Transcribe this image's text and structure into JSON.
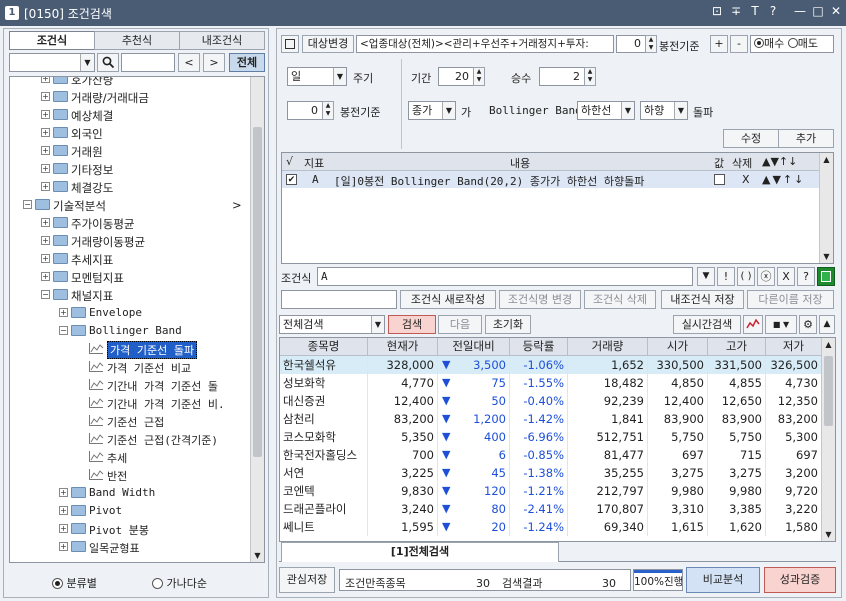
{
  "window": {
    "number": "1",
    "title": "[0150] 조건검색",
    "controls": [
      "⊡",
      "∓",
      "T",
      "?",
      "—",
      "□",
      "✕"
    ]
  },
  "left": {
    "tabs": [
      "조건식",
      "추천식",
      "내조건식"
    ],
    "search_nav": [
      "<",
      ">"
    ],
    "all_button": "전체",
    "tree": [
      {
        "label": "호가잔량",
        "indent": 1,
        "icon": "folder",
        "exp": "+"
      },
      {
        "label": "거래량/거래대금",
        "indent": 1,
        "icon": "folder",
        "exp": "+"
      },
      {
        "label": "예상체결",
        "indent": 1,
        "icon": "folder",
        "exp": "+"
      },
      {
        "label": "외국인",
        "indent": 1,
        "icon": "folder",
        "exp": "+"
      },
      {
        "label": "거래원",
        "indent": 1,
        "icon": "folder",
        "exp": "+"
      },
      {
        "label": "기타정보",
        "indent": 1,
        "icon": "folder",
        "exp": "+"
      },
      {
        "label": "체결강도",
        "indent": 1,
        "icon": "folder",
        "exp": "+"
      },
      {
        "label": "기술적분석",
        "indent": 0,
        "icon": "folder",
        "exp": "−",
        "arrow": ">"
      },
      {
        "label": "주가이동평균",
        "indent": 1,
        "icon": "folder",
        "exp": "+"
      },
      {
        "label": "거래량이동평균",
        "indent": 1,
        "icon": "folder",
        "exp": "+"
      },
      {
        "label": "추세지표",
        "indent": 1,
        "icon": "folder",
        "exp": "+"
      },
      {
        "label": "모멘텀지표",
        "indent": 1,
        "icon": "folder",
        "exp": "+"
      },
      {
        "label": "채널지표",
        "indent": 1,
        "icon": "folder",
        "exp": "−"
      },
      {
        "label": "Envelope",
        "indent": 2,
        "icon": "folder",
        "exp": "+"
      },
      {
        "label": "Bollinger Band",
        "indent": 2,
        "icon": "folder",
        "exp": "−"
      },
      {
        "label": "가격 기준선 돌파",
        "indent": 3,
        "icon": "chart",
        "selected": true
      },
      {
        "label": "가격 기준선 비교",
        "indent": 3,
        "icon": "chart"
      },
      {
        "label": "기간내 가격 기준선 돌",
        "indent": 3,
        "icon": "chart"
      },
      {
        "label": "기간내 가격 기준선 비.",
        "indent": 3,
        "icon": "chart"
      },
      {
        "label": "기준선 근접",
        "indent": 3,
        "icon": "chart"
      },
      {
        "label": "기준선 근접(간격기준)",
        "indent": 3,
        "icon": "chart"
      },
      {
        "label": "추세",
        "indent": 3,
        "icon": "chart"
      },
      {
        "label": "반전",
        "indent": 3,
        "icon": "chart"
      },
      {
        "label": "Band Width",
        "indent": 2,
        "icon": "folder",
        "exp": "+"
      },
      {
        "label": "Pivot",
        "indent": 2,
        "icon": "folder",
        "exp": "+"
      },
      {
        "label": "Pivot 분봉",
        "indent": 2,
        "icon": "folder",
        "exp": "+"
      },
      {
        "label": "일목균형표",
        "indent": 2,
        "icon": "folder",
        "exp": "+"
      }
    ],
    "radio": [
      "분류별",
      "가나다순"
    ]
  },
  "cond": {
    "target_btn": "대상변경",
    "target_text": "<업종대상(전체)><관리+우선주+거래정지+투자:",
    "bong": "0",
    "bong_label": "봉전기준",
    "plus": "+",
    "minus": "-",
    "buy": "매수",
    "sell": "매도",
    "period_unit": "일",
    "period_label": "주기",
    "range_label": "기간",
    "range_val": "20",
    "mult_label": "승수",
    "mult_val": "2",
    "bong2": "0",
    "bong2_label": "봉전기준",
    "price_sel": "종가",
    "ga": "가",
    "bb_label": "Bollinger Band",
    "line_sel": "하한선",
    "dir_sel": "하향",
    "breakout": "돌파",
    "edit_btn": "수정",
    "add_btn": "추가"
  },
  "ind_table": {
    "headers": [
      "√",
      "지표",
      "내용",
      "값",
      "삭제",
      "▲▼↑↓"
    ],
    "rows": [
      {
        "check": "✔",
        "letter": "A",
        "content": "[일]0봉전 Bollinger Band(20,2) 종가가 하한선 하향돌파",
        "del": "X",
        "moves": "▲▼↑↓"
      }
    ]
  },
  "formula": {
    "label": "조건식",
    "value": "A",
    "tools": [
      "▼",
      "!",
      "( )",
      "ⓧ",
      "X",
      "?"
    ]
  },
  "actions": {
    "new": "조건식 새로작성",
    "rename": "조건식명 변경",
    "delete": "조건식 삭제",
    "save": "내조건식 저장",
    "saveas": "다른이름 저장"
  },
  "search": {
    "mode": "전체검색",
    "search": "검색",
    "next": "다음",
    "reset": "초기화",
    "realtime": "실시간검색"
  },
  "results": {
    "headers": [
      "종목명",
      "현재가",
      "전일대비",
      "등락률",
      "거래량",
      "시가",
      "고가",
      "저가"
    ],
    "rows": [
      [
        "한국쉘석유",
        "328,000",
        "3,500",
        "-1.06%",
        "1,652",
        "330,500",
        "331,500",
        "326,500"
      ],
      [
        "성보화학",
        "4,770",
        "75",
        "-1.55%",
        "18,482",
        "4,850",
        "4,855",
        "4,730"
      ],
      [
        "대신증권",
        "12,400",
        "50",
        "-0.40%",
        "92,239",
        "12,400",
        "12,650",
        "12,350"
      ],
      [
        "삼천리",
        "83,200",
        "1,200",
        "-1.42%",
        "1,841",
        "83,900",
        "83,900",
        "83,200"
      ],
      [
        "코스모화학",
        "5,350",
        "400",
        "-6.96%",
        "512,751",
        "5,750",
        "5,750",
        "5,300"
      ],
      [
        "한국전자홀딩스",
        "700",
        "6",
        "-0.85%",
        "81,477",
        "697",
        "715",
        "697"
      ],
      [
        "서연",
        "3,225",
        "45",
        "-1.38%",
        "35,255",
        "3,275",
        "3,275",
        "3,200"
      ],
      [
        "코엔텍",
        "9,830",
        "120",
        "-1.21%",
        "212,797",
        "9,980",
        "9,980",
        "9,720"
      ],
      [
        "드래곤플라이",
        "3,240",
        "80",
        "-2.41%",
        "170,807",
        "3,310",
        "3,385",
        "3,220"
      ],
      [
        "쎄니트",
        "1,595",
        "20",
        "-1.24%",
        "69,340",
        "1,615",
        "1,620",
        "1,580"
      ]
    ],
    "down_glyph": "▼"
  },
  "result_tab": "[1]전체검색",
  "bottom": {
    "save": "관심저장",
    "cond_count_label": "조건만족종목",
    "cond_count": "30",
    "result_label": "검색결과",
    "result_count": "30",
    "progress_text": "100%진행",
    "progress": 1.0,
    "compare": "비교분석",
    "perf": "성과검증"
  }
}
